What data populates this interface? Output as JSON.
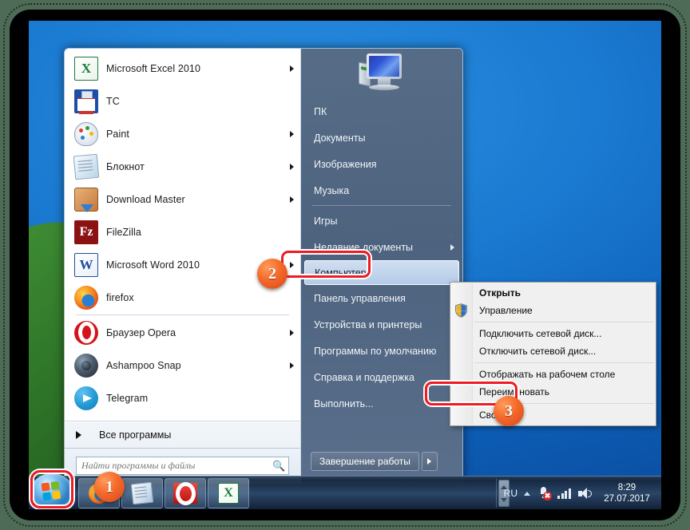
{
  "desktop": {
    "wallpaper_color": "#1a79d0",
    "frame_color": "#4d6b57"
  },
  "start_menu": {
    "programs": [
      {
        "label": "Microsoft Excel 2010",
        "icon": "excel-icon",
        "arrow": true
      },
      {
        "label": "TC",
        "icon": "total-commander-icon",
        "arrow": false
      },
      {
        "label": "Paint",
        "icon": "paint-icon",
        "arrow": true
      },
      {
        "label": "Блокнот",
        "icon": "notepad-icon",
        "arrow": true
      },
      {
        "label": "Download Master",
        "icon": "download-master-icon",
        "arrow": true
      },
      {
        "label": "FileZilla",
        "icon": "filezilla-icon",
        "arrow": false
      },
      {
        "label": "Microsoft Word 2010",
        "icon": "word-icon",
        "arrow": true
      },
      {
        "label": "firefox",
        "icon": "firefox-icon",
        "arrow": false
      },
      {
        "label": "Браузер Opera",
        "icon": "opera-icon",
        "arrow": true
      },
      {
        "label": "Ashampoo Snap",
        "icon": "ashampoo-snap-icon",
        "arrow": true
      },
      {
        "label": "Telegram",
        "icon": "telegram-icon",
        "arrow": false
      }
    ],
    "all_programs_label": "Все программы",
    "search": {
      "placeholder": "Найти программы и файлы",
      "value": "",
      "icon": "search-icon"
    },
    "right_pane": {
      "user_picture_icon": "computer-monitor-icon",
      "items": [
        {
          "label": "ПК",
          "arrow": false,
          "selected": false
        },
        {
          "label": "Документы",
          "arrow": false,
          "selected": false
        },
        {
          "label": "Изображения",
          "arrow": false,
          "selected": false
        },
        {
          "label": "Музыка",
          "arrow": false,
          "selected": false
        },
        {
          "label": "Игры",
          "arrow": false,
          "selected": false
        },
        {
          "label": "Недавние документы",
          "arrow": true,
          "selected": false
        },
        {
          "label": "Компьютер",
          "arrow": false,
          "selected": true
        },
        {
          "label": "Панель управления",
          "arrow": false,
          "selected": false
        },
        {
          "label": "Устройства и принтеры",
          "arrow": false,
          "selected": false
        },
        {
          "label": "Программы по умолчанию",
          "arrow": false,
          "selected": false
        },
        {
          "label": "Справка и поддержка",
          "arrow": false,
          "selected": false
        },
        {
          "label": "Выполнить...",
          "arrow": false,
          "selected": false
        }
      ],
      "shutdown_label": "Завершение работы",
      "shutdown_arrow_icon": "chevron-right-icon"
    }
  },
  "context_menu": {
    "items": [
      {
        "label": "Открыть",
        "bold": true,
        "shield": false
      },
      {
        "label": "Управление",
        "bold": false,
        "shield": true
      },
      {
        "label": "Подключить сетевой диск...",
        "bold": false,
        "shield": false
      },
      {
        "label": "Отключить сетевой диск...",
        "bold": false,
        "shield": false
      },
      {
        "label": "Отображать на рабочем столе",
        "bold": false,
        "shield": false
      },
      {
        "label": "Переименовать",
        "bold": false,
        "shield": false
      },
      {
        "label": "Свойства",
        "bold": false,
        "shield": false
      }
    ]
  },
  "annotations": {
    "badges": [
      {
        "number": "1",
        "target": "start-button"
      },
      {
        "number": "2",
        "target": "computer-menu-item"
      },
      {
        "number": "3",
        "target": "properties-menu-item"
      }
    ],
    "highlight_color": "#ee1b24"
  },
  "taskbar": {
    "start_button_icon": "windows-start-orb-icon",
    "buttons": [
      {
        "icon": "firefox-icon",
        "active": false
      },
      {
        "icon": "notepad-icon",
        "active": false
      },
      {
        "icon": "opera-icon",
        "active": false
      },
      {
        "icon": "excel-icon",
        "active": false
      }
    ],
    "tray": {
      "language": "RU",
      "show_hidden_icon": "chevron-up-icon",
      "icons": [
        "network-plug-error-icon",
        "network-signal-icon",
        "volume-icon"
      ],
      "time": "8:29",
      "date": "27.07.2017"
    }
  }
}
